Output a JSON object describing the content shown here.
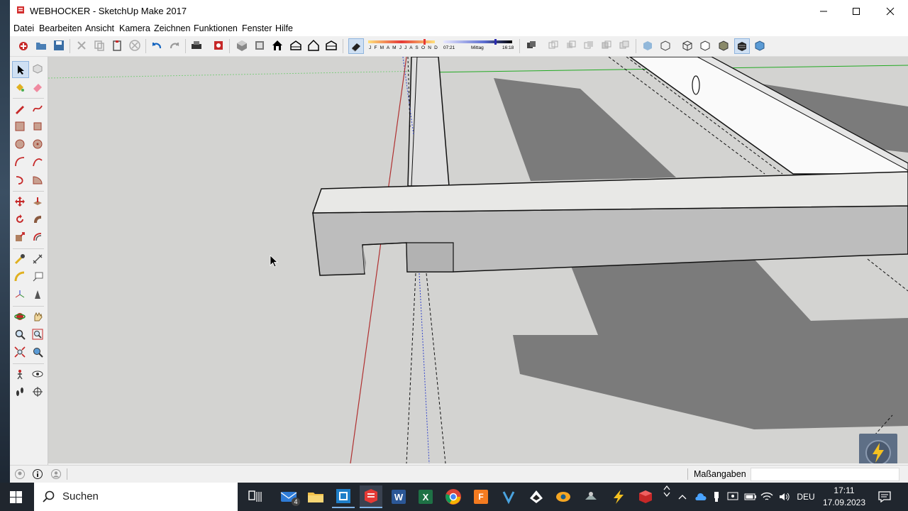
{
  "window": {
    "title": "WEBHOCKER - SketchUp Make 2017",
    "minimize_icon": "minimize-icon",
    "maximize_icon": "maximize-icon",
    "close_icon": "close-icon"
  },
  "menu": [
    "Datei",
    "Bearbeiten",
    "Ansicht",
    "Kamera",
    "Zeichnen",
    "Funktionen",
    "Fenster",
    "Hilfe"
  ],
  "shadow_widget": {
    "months": "J F M A M J J A S O N D",
    "time_start": "07:21",
    "time_mid": "Mittag",
    "time_end": "16:18"
  },
  "toolbar_icons": [
    "new-icon",
    "open-icon",
    "save-icon",
    "cut-icon",
    "copy-icon",
    "paste-icon",
    "erase-icon",
    "undo-icon",
    "redo-icon",
    "print-icon",
    "model-info-icon",
    "iso-view-icon",
    "top-view-icon",
    "front-view-icon",
    "right-view-icon",
    "back-view-icon",
    "left-view-icon",
    "shadows-icon",
    "section-plane-icon",
    "union-icon",
    "subtract-icon",
    "intersect-icon",
    "trim-icon",
    "split-icon",
    "xray-icon",
    "wireframe-icon",
    "hidden-line-icon",
    "shaded-icon",
    "textured-icon",
    "monochrome-icon",
    "styles-icon"
  ],
  "status": {
    "measure_label": "Maßangaben",
    "measure_value": ""
  },
  "taskbar": {
    "search_placeholder": "Suchen",
    "mail_badge": "4",
    "language": "DEU",
    "time": "17:11",
    "date": "17.09.2023"
  },
  "colors": {
    "viewport_bg": "#d2d2d0",
    "shadow": "#7a7a7a",
    "red_axis": "#c0392b",
    "green_axis": "#22aa22",
    "blue_axis": "#3344cc",
    "taskbar": "#20262e"
  }
}
